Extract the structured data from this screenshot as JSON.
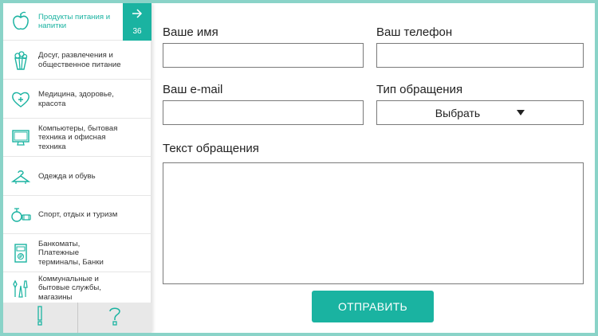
{
  "sidebar": {
    "categories": [
      {
        "label": "Продукты питания и напитки",
        "icon": "apple-icon",
        "active": true
      },
      {
        "label": "Досуг, развлечения и общественное питание",
        "icon": "popcorn-icon"
      },
      {
        "label": "Медицина, здоровье, красота",
        "icon": "heart-plus-icon"
      },
      {
        "label": "Компьютеры, бытовая техника и офисная техника",
        "icon": "monitor-icon"
      },
      {
        "label": "Одежда и обувь",
        "icon": "hanger-icon"
      },
      {
        "label": "Спорт, отдых и туризм",
        "icon": "dumbbell-icon"
      },
      {
        "label": "Банкоматы, Платежные терминалы, Банки",
        "icon": "atm-icon"
      },
      {
        "label": "Коммунальные и бытовые службы, магазины",
        "icon": "tools-icon"
      }
    ],
    "active_count": "36",
    "bottom_buttons": [
      {
        "label": "!",
        "icon": "exclamation-icon"
      },
      {
        "label": "?",
        "icon": "question-icon"
      }
    ]
  },
  "form": {
    "name_label": "Ваше имя",
    "phone_label": "Ваш телефон",
    "email_label": "Ваш e-mail",
    "type_label": "Тип обращения",
    "type_value": "Выбрать",
    "text_label": "Текст обращения",
    "submit_label": "ОТПРАВИТЬ"
  },
  "colors": {
    "accent": "#1ab3a1",
    "frame": "#8ad3c8"
  }
}
